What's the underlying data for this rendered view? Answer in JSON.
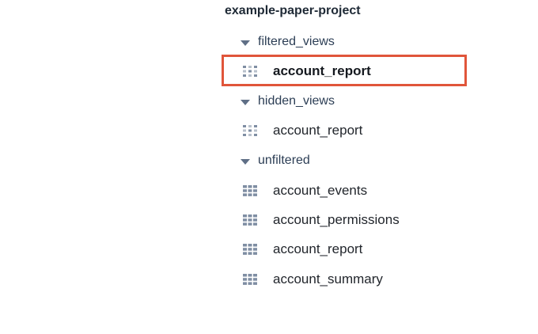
{
  "project": {
    "title": "example-paper-project"
  },
  "tree": {
    "datasets": [
      {
        "label": "filtered_views",
        "icon": "triangle-down-icon",
        "items": [
          {
            "label": "account_report",
            "icon": "view-icon",
            "selected": true
          }
        ]
      },
      {
        "label": "hidden_views",
        "icon": "triangle-down-icon",
        "items": [
          {
            "label": "account_report",
            "icon": "view-icon",
            "selected": false
          }
        ]
      },
      {
        "label": "unfiltered",
        "icon": "triangle-down-icon",
        "items": [
          {
            "label": "account_events",
            "icon": "table-grid-icon",
            "selected": false
          },
          {
            "label": "account_permissions",
            "icon": "table-grid-icon",
            "selected": false
          },
          {
            "label": "account_report",
            "icon": "table-grid-icon",
            "selected": false
          },
          {
            "label": "account_summary",
            "icon": "table-grid-icon",
            "selected": false
          }
        ]
      }
    ]
  },
  "colors": {
    "highlight": "#e0553a",
    "icon": "#7f8ea3",
    "triangle": "#5f6f86"
  }
}
